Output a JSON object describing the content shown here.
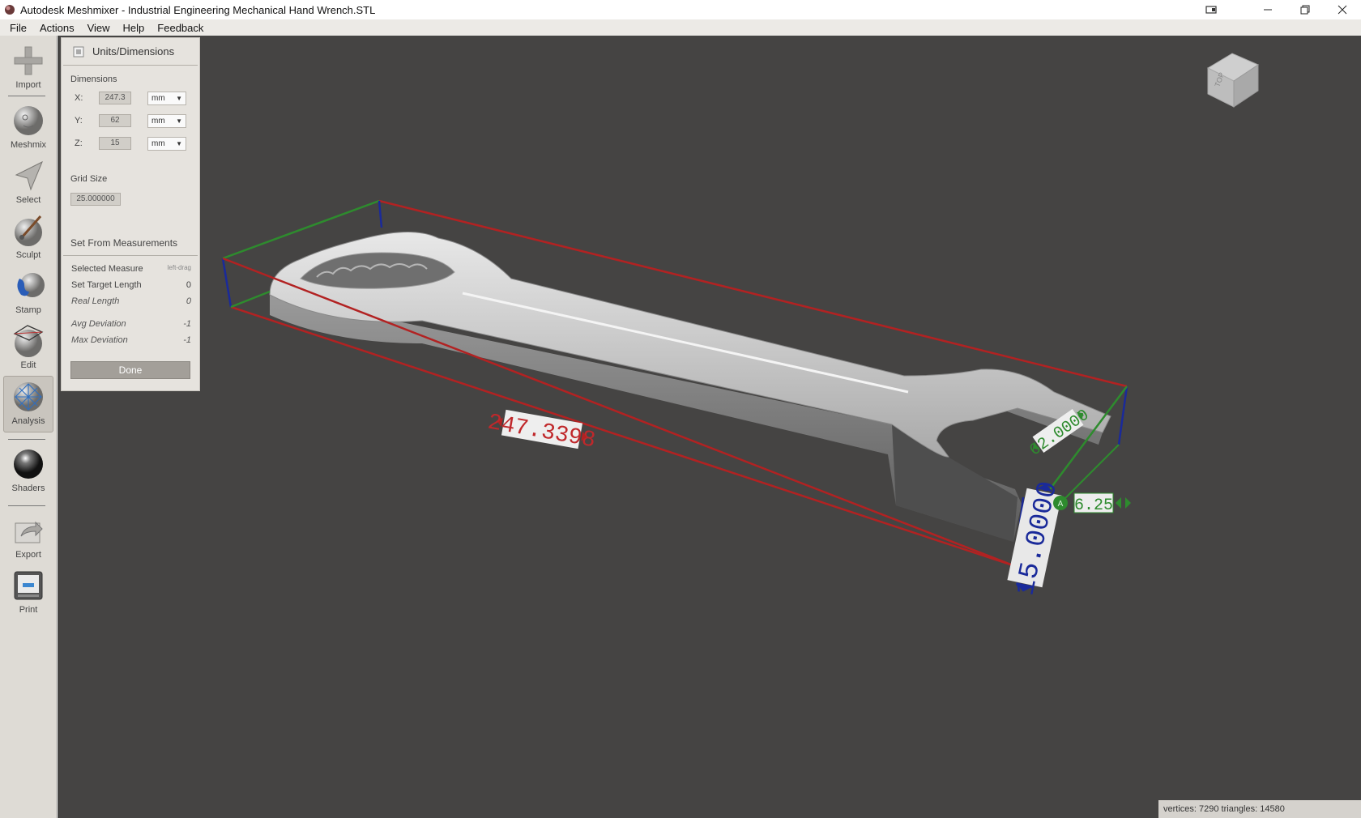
{
  "window": {
    "title": "Autodesk Meshmixer - Industrial Engineering Mechanical Hand Wrench.STL",
    "controls": [
      "minimize",
      "restore",
      "close"
    ]
  },
  "menu": [
    "File",
    "Actions",
    "View",
    "Help",
    "Feedback"
  ],
  "tools": [
    {
      "label": "Import",
      "icon": "plus-icon"
    },
    {
      "label": "Meshmix",
      "icon": "meshmix-icon"
    },
    {
      "label": "Select",
      "icon": "arrow-cursor-icon"
    },
    {
      "label": "Sculpt",
      "icon": "brush-icon"
    },
    {
      "label": "Stamp",
      "icon": "stamp-icon"
    },
    {
      "label": "Edit",
      "icon": "edit-sphere-icon"
    },
    {
      "label": "Analysis",
      "icon": "analysis-sphere-icon",
      "active": true
    },
    {
      "label": "Shaders",
      "icon": "shader-sphere-icon"
    },
    {
      "label": "Export",
      "icon": "export-icon"
    },
    {
      "label": "Print",
      "icon": "printer-icon"
    }
  ],
  "panel": {
    "title": "Units/Dimensions",
    "dimensions_label": "Dimensions",
    "dims": [
      {
        "axis": "X:",
        "value": "247.3",
        "unit": "mm"
      },
      {
        "axis": "Y:",
        "value": "62",
        "unit": "mm"
      },
      {
        "axis": "Z:",
        "value": "15",
        "unit": "mm"
      }
    ],
    "grid_label": "Grid Size",
    "grid_value": "25.000000",
    "set_from_label": "Set From Measurements",
    "measures": [
      {
        "label": "Selected Measure",
        "value": "left-drag"
      },
      {
        "label": "Set Target Length",
        "value": "0"
      },
      {
        "label": "Real Length",
        "value": "0"
      },
      {
        "label": "Avg Deviation",
        "value": "-1"
      },
      {
        "label": "Max Deviation",
        "value": "-1"
      }
    ],
    "done_label": "Done"
  },
  "viewport": {
    "background": "#454443",
    "measure_x": "247.3398",
    "measure_y": "62.0000",
    "measure_z": "15.0000",
    "measure_side": "6.25",
    "view_cube_label": "TOP",
    "status": "vertices: 7290 triangles: 14580",
    "colors": {
      "x_axis": "#b22222",
      "y_axis": "#2e8b2e",
      "z_axis": "#1a2a9a"
    }
  }
}
